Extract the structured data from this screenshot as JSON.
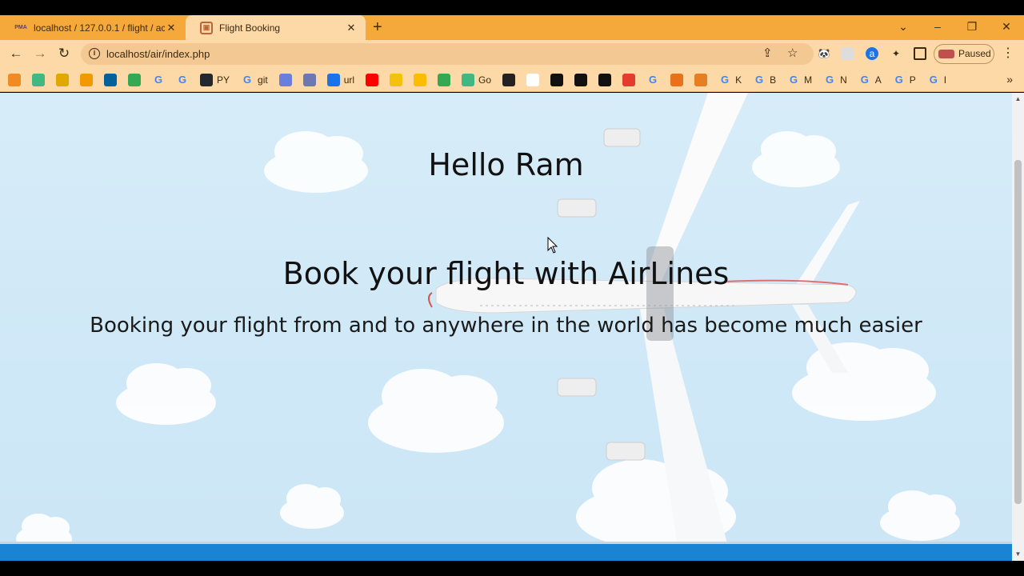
{
  "browser": {
    "tabs": [
      {
        "title": "localhost / 127.0.0.1 / flight / acc",
        "favicon": "PMA",
        "active": false
      },
      {
        "title": "Flight Booking",
        "favicon": "▣",
        "active": true
      }
    ],
    "new_tab": "+",
    "window_controls": {
      "dropdown": "⌄",
      "minimize": "–",
      "restore": "❐",
      "close": "✕"
    },
    "url": "localhost/air/index.php",
    "profile_status": "Paused",
    "bookmarks": [
      {
        "icon": "orange-diamond-icon",
        "label": "",
        "color": "#f08a24"
      },
      {
        "icon": "vue-icon",
        "label": "",
        "color": "#41b883"
      },
      {
        "icon": "notes-icon",
        "label": "",
        "color": "#e0a800"
      },
      {
        "icon": "analytics-icon",
        "label": "",
        "color": "#f29900"
      },
      {
        "icon": "ieee-icon",
        "label": "",
        "color": "#00629b"
      },
      {
        "icon": "green-circle-icon",
        "label": "",
        "color": "#34a853"
      },
      {
        "icon": "google-icon",
        "label": "",
        "color": "#4285f4"
      },
      {
        "icon": "google-icon",
        "label": "",
        "color": "#4285f4"
      },
      {
        "icon": "github-icon",
        "label": "PY",
        "color": "#24292e"
      },
      {
        "icon": "google-icon",
        "label": "git",
        "color": "#4285f4"
      },
      {
        "icon": "flag-icon",
        "label": "",
        "color": "#6a7fdb"
      },
      {
        "icon": "pma-icon",
        "label": "",
        "color": "#6c78af"
      },
      {
        "icon": "wifi-icon",
        "label": "url",
        "color": "#1a73e8"
      },
      {
        "icon": "youtube-icon",
        "label": "",
        "color": "#ff0000"
      },
      {
        "icon": "p-icon",
        "label": "",
        "color": "#f4c20d"
      },
      {
        "icon": "folder-icon",
        "label": "",
        "color": "#fbbc04"
      },
      {
        "icon": "ring-icon",
        "label": "",
        "color": "#34a853"
      },
      {
        "icon": "vue-icon",
        "label": "Go",
        "color": "#41b883"
      },
      {
        "icon": "bookmark-icon",
        "label": "",
        "color": "#222222"
      },
      {
        "icon": "doc-icon",
        "label": "",
        "color": "#ffffff"
      },
      {
        "icon": "cp-icon",
        "label": "",
        "color": "#111111"
      },
      {
        "icon": "black-circle-icon",
        "label": "",
        "color": "#111111"
      },
      {
        "icon": "black-circle-icon",
        "label": "",
        "color": "#111111"
      },
      {
        "icon": "yandex-icon",
        "label": "",
        "color": "#e33b2e"
      },
      {
        "icon": "google-icon",
        "label": "",
        "color": "#4285f4"
      },
      {
        "icon": "triangle-icon",
        "label": "",
        "color": "#e8711a"
      },
      {
        "icon": "tiger-icon",
        "label": "",
        "color": "#e67e22"
      },
      {
        "icon": "google-icon",
        "label": "K",
        "color": "#4285f4"
      },
      {
        "icon": "google-icon",
        "label": "B",
        "color": "#4285f4"
      },
      {
        "icon": "google-icon",
        "label": "M",
        "color": "#4285f4"
      },
      {
        "icon": "google-icon",
        "label": "N",
        "color": "#4285f4"
      },
      {
        "icon": "google-icon",
        "label": "A",
        "color": "#4285f4"
      },
      {
        "icon": "google-icon",
        "label": "P",
        "color": "#4285f4"
      },
      {
        "icon": "google-icon",
        "label": "I",
        "color": "#4285f4"
      }
    ],
    "bookmarks_overflow": "»"
  },
  "page": {
    "greeting": "Hello Ram",
    "headline": "Book your flight with AirLines",
    "subheadline": "Booking your flight from and to anywhere in the world has become much easier"
  },
  "colors": {
    "tab_strip": "#f6a93b",
    "toolbar": "#fcd9a6",
    "sky": "#d7ecf8",
    "footer": "#1a84d4"
  }
}
